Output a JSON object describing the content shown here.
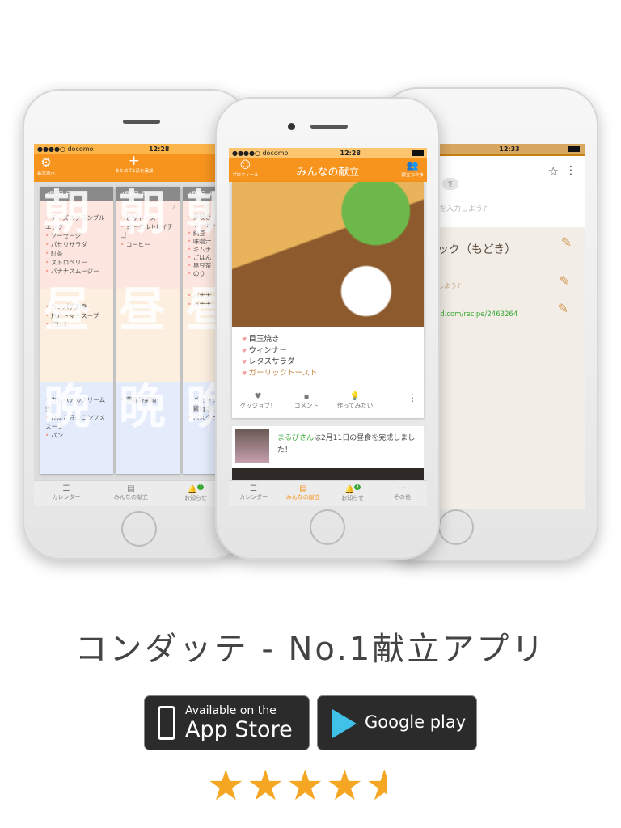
{
  "colors": {
    "accent": "#f7941d",
    "star": "#f5a623",
    "green": "#3aa935"
  },
  "left_phone": {
    "status": {
      "carrier": "●●●●○ docomo",
      "time": "12:28"
    },
    "header": {
      "settings_label": "基本表示",
      "add_label": "まとめて1品を追加",
      "settings_icon": "gear-icon",
      "add_icon": "plus-icon"
    },
    "columns": [
      {
        "date": "2月7日 日",
        "breakfast": [
          "チーズスクランブルエッグ",
          "ソーセージ",
          "パセリサラダ",
          "紅茶",
          "ストロベリー",
          "バナナスムージー"
        ],
        "lunch": [
          "カンパチ刺身",
          "魚介トマトスープ",
          "ごはん"
        ],
        "dinner": [
          "カンパチのクリーム煮",
          "ひよこ豆のコンソメスープ",
          "パン"
        ]
      },
      {
        "date": "2月8日 月",
        "comment_count": "2",
        "breakfast": [
          "ピザトースト",
          "ヨーグルト&イチゴ",
          "コーヒー"
        ],
        "lunch": [],
        "dinner": [
          "薬膳野菜鍋"
        ]
      },
      {
        "date": "2月9日 火",
        "breakfast": [
          "卵焼き",
          "ソーセージ",
          "納豆",
          "味噌汁",
          "キムチ",
          "ごはん",
          "黒豆茶",
          "のり"
        ],
        "lunch": [
          "バナナ",
          "バナナ"
        ],
        "dinner": [
          "パセリサ",
          "鶏肉のマ",
          "パスタビ"
        ]
      }
    ],
    "meal_watermarks": [
      "朝",
      "昼",
      "晩"
    ],
    "tabs": [
      {
        "label": "カレンダー",
        "icon": "list-icon"
      },
      {
        "label": "みんなの献立",
        "icon": "chat-icon"
      },
      {
        "label": "お知らせ",
        "icon": "bell-icon",
        "badge": "1"
      }
    ]
  },
  "center_phone": {
    "status": {
      "carrier": "●●●●○ docomo",
      "time": "12:28"
    },
    "header": {
      "title": "みんなの献立",
      "profile_label": "プロフィール",
      "friends_label": "献立なかま"
    },
    "post": {
      "items": [
        "目玉焼き",
        "ウィンナー",
        "レタスサラダ"
      ],
      "highlight_item": "ガーリックトースト",
      "actions": [
        "グッジョブ！",
        "コメント",
        "作ってみたい"
      ]
    },
    "feed": {
      "user": "まるぴさん",
      "message": "は2月11日の昼食を完成しました！"
    },
    "tabs": [
      {
        "label": "カレンダー",
        "icon": "list-icon"
      },
      {
        "label": "みんなの献立",
        "icon": "chat-icon",
        "active": true
      },
      {
        "label": "お知らせ",
        "icon": "bell-icon",
        "badge": "1"
      },
      {
        "label": "その他",
        "icon": "more-icon"
      }
    ]
  },
  "right_phone": {
    "status": {
      "time": "12:33"
    },
    "season_tag": "冬",
    "hint1": "を入力しよう♪",
    "recipe_title": "ック（もどき）",
    "hint2": "しよう♪",
    "url": "ad.com/recipe/2463264"
  },
  "footer": {
    "title": "コンダッテ - No.1献立アプリ",
    "appstore_small": "Available on the",
    "appstore_big": "App Store",
    "google": "Google play",
    "rating": 4.5
  }
}
